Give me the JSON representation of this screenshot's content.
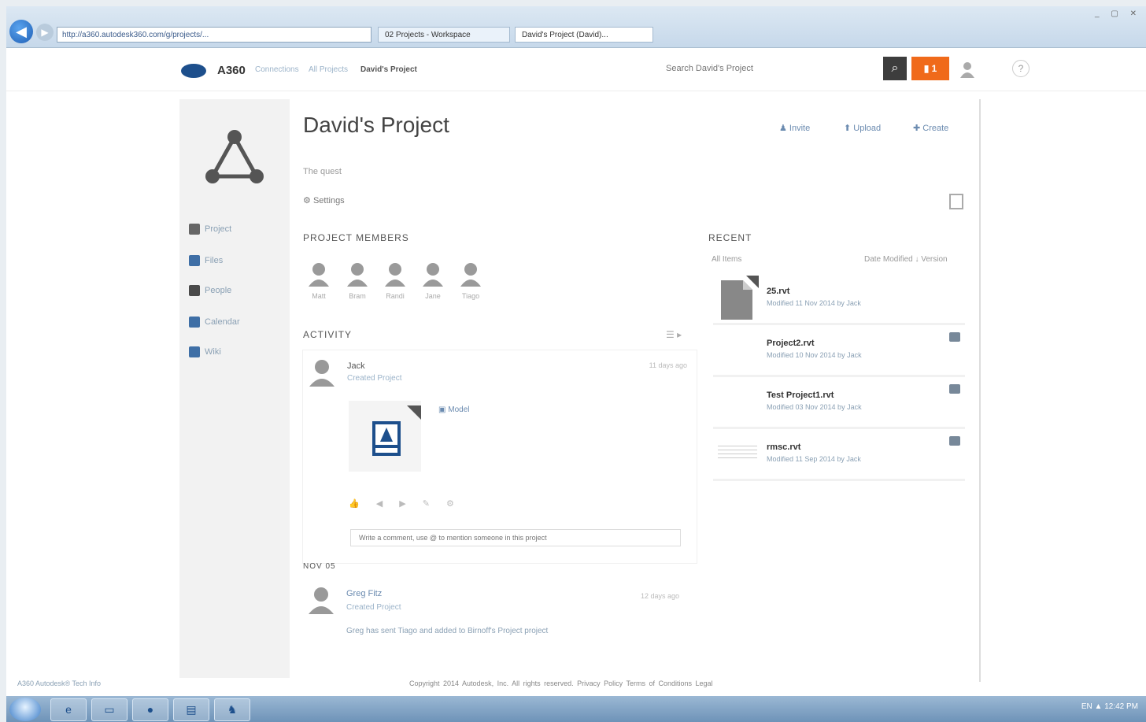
{
  "browser": {
    "back_icon": "back-arrow-icon",
    "address": "http://a360.autodesk360.com/g/projects/...",
    "tabs": [
      "02 Projects - Workspace",
      "David's Project (David)..."
    ],
    "window_controls": "_ ▢ ✕"
  },
  "header": {
    "app_name": "A360",
    "breadcrumb": [
      "Connections",
      "All Projects",
      "David's Project"
    ],
    "search_placeholder": "Search David's Project",
    "notification_count": "1",
    "help_label": "?"
  },
  "sidebar": {
    "items": [
      {
        "label": "Project",
        "icon": "members-icon"
      },
      {
        "label": "Files",
        "icon": "files-icon"
      },
      {
        "label": "People",
        "icon": "people-icon"
      },
      {
        "label": "Calendar",
        "icon": "calendar-icon"
      },
      {
        "label": "Wiki",
        "icon": "wiki-icon"
      }
    ]
  },
  "main": {
    "title": "David's Project",
    "actions": [
      "Invite",
      "Upload",
      "Create"
    ],
    "description": "The quest",
    "settings_label": "Settings",
    "members_heading": "PROJECT MEMBERS",
    "members": [
      "Matt",
      "Bram",
      "Randi",
      "Jane",
      "Tiago"
    ],
    "activity_heading": "ACTIVITY",
    "activity_post": {
      "author": "Jack",
      "action": "Created Project",
      "time": "11 days ago",
      "attachment": "Model"
    },
    "comment_placeholder": "Write a comment, use @ to mention someone in this project",
    "section_label": "NOV 05",
    "second_post": {
      "author": "Greg Fitz",
      "action": "Created Project",
      "time": "12 days ago",
      "body": "Greg has sent Tiago and added to Birnoff's Project project"
    }
  },
  "recent": {
    "heading": "RECENT",
    "filter": "All Items",
    "sort": "Date Modified ↓  Version",
    "items": [
      {
        "name": "25.rvt",
        "date": "Modified 11 Nov 2014 by Jack"
      },
      {
        "name": "Project2.rvt",
        "date": "Modified 10 Nov 2014 by Jack"
      },
      {
        "name": "Test Project1.rvt",
        "date": "Modified 03 Nov 2014 by Jack"
      },
      {
        "name": "rmsc.rvt",
        "date": "Modified 11 Sep 2014 by Jack"
      }
    ]
  },
  "footer": {
    "left": "A360 Autodesk® Tech Info",
    "copyright": "Copyright 2014 Autodesk, Inc. All rights reserved.  Privacy Policy  Terms of Conditions  Legal"
  },
  "taskbar": {
    "tray": "EN  ▲  12:42 PM"
  }
}
